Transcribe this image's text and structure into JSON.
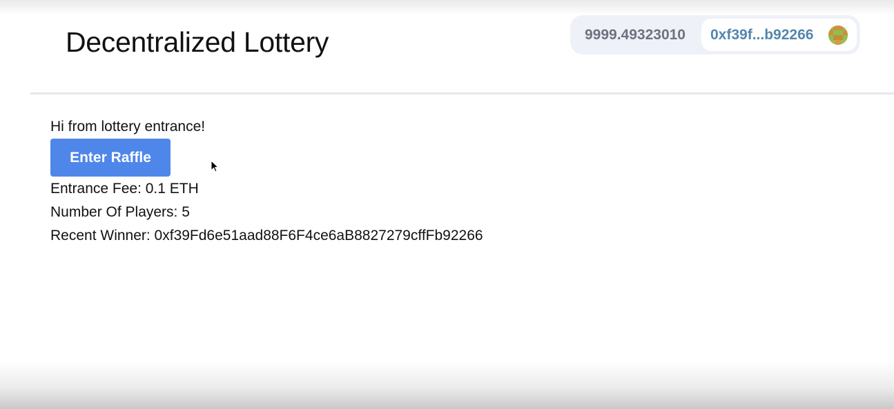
{
  "header": {
    "title": "Decentralized Lottery"
  },
  "wallet": {
    "balance": "9999.49323010",
    "account_short": "0xf39f...b92266"
  },
  "lottery": {
    "greeting": "Hi from lottery entrance!",
    "enter_button_label": "Enter Raffle",
    "entrance_fee": "Entrance Fee: 0.1 ETH",
    "number_of_players": "Number Of Players: 5",
    "recent_winner": "Recent Winner: 0xf39Fd6e51aad88F6F4ce6aB8827279cffFb92266"
  },
  "colors": {
    "button_bg": "#4f86ea",
    "address_text": "#5386ad",
    "balance_text": "#6d737e",
    "pill_bg": "#eef1f7"
  }
}
